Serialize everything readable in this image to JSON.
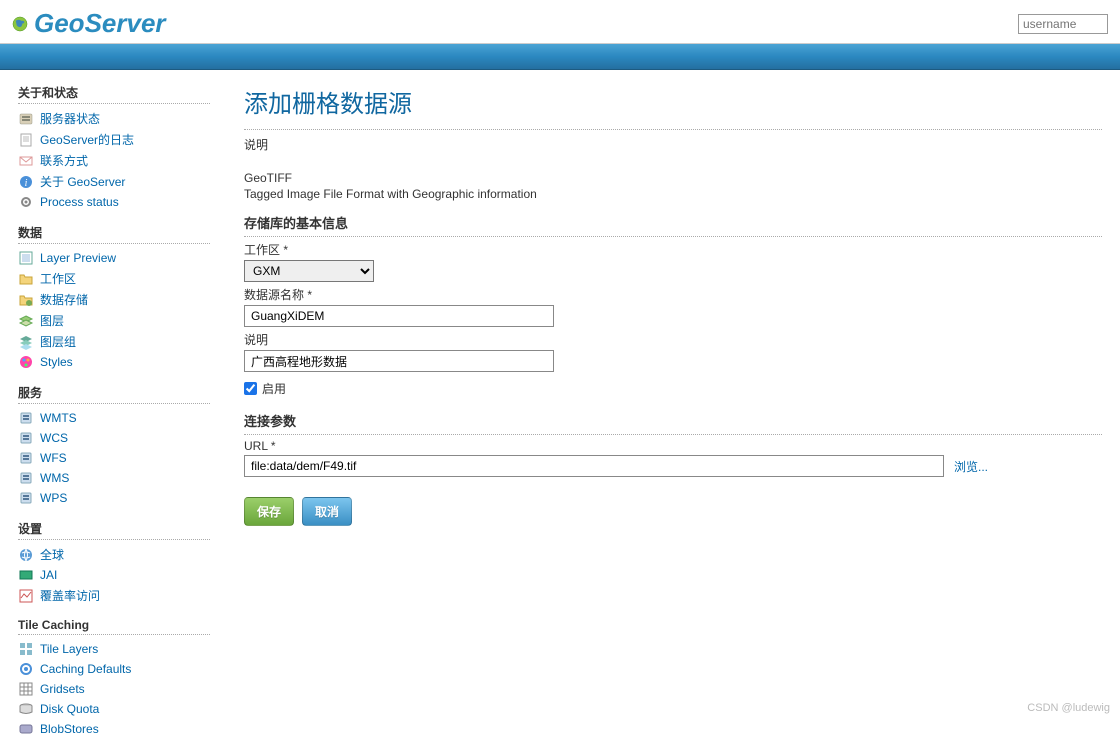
{
  "header": {
    "logo_text": "GeoServer",
    "username_placeholder": "username"
  },
  "sidebar": {
    "cat_about": "关于和状态",
    "about_items": [
      {
        "label": "服务器状态",
        "icon": "server-icon"
      },
      {
        "label": "GeoServer的日志",
        "icon": "page-icon"
      },
      {
        "label": "联系方式",
        "icon": "mail-icon"
      },
      {
        "label": "关于 GeoServer",
        "icon": "info-icon"
      },
      {
        "label": "Process status",
        "icon": "gear-icon"
      }
    ],
    "cat_data": "数据",
    "data_items": [
      {
        "label": "Layer Preview",
        "icon": "layer-icon"
      },
      {
        "label": "工作区",
        "icon": "folder-icon"
      },
      {
        "label": "数据存储",
        "icon": "db-folder-icon"
      },
      {
        "label": "图层",
        "icon": "layer2-icon"
      },
      {
        "label": "图层组",
        "icon": "layergroup-icon"
      },
      {
        "label": "Styles",
        "icon": "palette-icon"
      }
    ],
    "cat_services": "服务",
    "service_items": [
      {
        "label": "WMTS"
      },
      {
        "label": "WCS"
      },
      {
        "label": "WFS"
      },
      {
        "label": "WMS"
      },
      {
        "label": "WPS"
      }
    ],
    "cat_settings": "设置",
    "settings_items": [
      {
        "label": "全球",
        "icon": "globe-icon"
      },
      {
        "label": "JAI",
        "icon": "jai-icon"
      },
      {
        "label": "覆盖率访问",
        "icon": "coverage-icon"
      }
    ],
    "cat_tile": "Tile Caching",
    "tile_items": [
      {
        "label": "Tile Layers",
        "icon": "tile-icon"
      },
      {
        "label": "Caching Defaults",
        "icon": "gear2-icon"
      },
      {
        "label": "Gridsets",
        "icon": "grid-icon"
      },
      {
        "label": "Disk Quota",
        "icon": "disk-icon"
      },
      {
        "label": "BlobStores",
        "icon": "blob-icon"
      }
    ]
  },
  "main": {
    "title": "添加栅格数据源",
    "desc_label": "说明",
    "format_name": "GeoTIFF",
    "format_desc": "Tagged Image File Format with Geographic information",
    "basic_info_title": "存储库的基本信息",
    "workspace_label": "工作区 *",
    "workspace_value": "GXM",
    "datasource_name_label": "数据源名称 *",
    "datasource_name_value": "GuangXiDEM",
    "desc2_label": "说明",
    "desc2_value": "广西高程地形数据",
    "enable_label": "启用",
    "enable_checked": true,
    "conn_params_title": "连接参数",
    "url_label": "URL *",
    "url_value": "file:data/dem/F49.tif",
    "browse_label": "浏览...",
    "save_label": "保存",
    "cancel_label": "取消"
  },
  "watermark": "CSDN @ludewig"
}
